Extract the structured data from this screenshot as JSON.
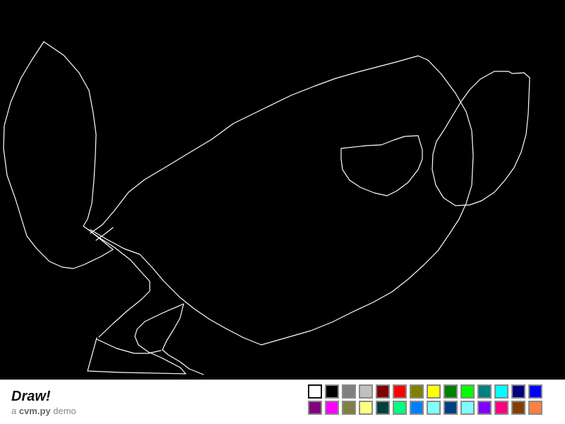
{
  "app": {
    "title": "Draw!",
    "subtitle_prefix": "a ",
    "subtitle_brand": "cvm.py",
    "subtitle_suffix": " demo"
  },
  "canvas": {
    "background": "#000000",
    "stroke_color": "#ffffff"
  },
  "palette": {
    "selected_index": 0,
    "colors": [
      "#ffffff",
      "#000000",
      "#808080",
      "#c0c0c0",
      "#800000",
      "#ff0000",
      "#808000",
      "#ffff00",
      "#008000",
      "#00ff00",
      "#008080",
      "#00ffff",
      "#000080",
      "#0000ff",
      "#800080",
      "#ff00ff",
      "#808040",
      "#ffff80",
      "#004040",
      "#00ff80",
      "#0080ff",
      "#80ffff",
      "#004080",
      "#80ffff",
      "#8000ff",
      "#ff0080",
      "#804000",
      "#ff8040"
    ]
  }
}
